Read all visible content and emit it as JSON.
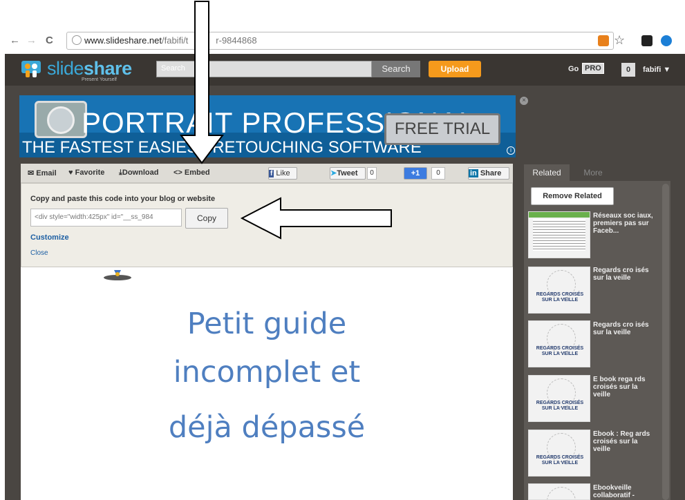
{
  "browser": {
    "url_host": "www.slideshare.net",
    "url_path": "/fabifi/t",
    "url_tail": "r-9844868"
  },
  "header": {
    "logo_slide": "slide",
    "logo_share": "share",
    "tagline": "Present Yourself",
    "search_placeholder": "Search",
    "search_button": "Search",
    "upload_button": "Upload",
    "go_label": "Go",
    "pro_label": "PRO",
    "notification_count": "0",
    "username": "fabifi ▼"
  },
  "ad": {
    "title": "PORTRAIT PROFESSIONAL",
    "subtitle": "THE FASTEST EASIEST RETOUCHING SOFTWARE",
    "cta": "FREE TRIAL",
    "close": "×",
    "info": "i"
  },
  "toolbar": {
    "email": "Email",
    "favorite": "Favorite",
    "download": "Download",
    "embed": "Embed",
    "like": "Like",
    "tweet": "Tweet",
    "tweet_count": "0",
    "plusone": "+1",
    "plusone_count": "0",
    "share": "Share"
  },
  "embed": {
    "title": "Copy and paste this code into your blog or website",
    "code": "<div style=\"width:425px\" id=\"__ss_984",
    "copy_button": "Copy",
    "customize": "Customize",
    "close": "Close"
  },
  "slide": {
    "lines": [
      "Petit guide",
      "incomplet et",
      "déjà dépassé"
    ]
  },
  "related": {
    "tab_related": "Related",
    "tab_more": "More",
    "remove_button": "Remove Related",
    "items": [
      {
        "title": "Réseaux soc iaux, premiers pas sur Faceb...",
        "thumb": "document"
      },
      {
        "title": "Regards cro isés sur la veille",
        "thumb": "regards"
      },
      {
        "title": "Regards cro isés sur la veille",
        "thumb": "regards"
      },
      {
        "title": "E book rega rds croisés sur la veille",
        "thumb": "regards"
      },
      {
        "title": "Ebook : Reg ards croisés sur la veille",
        "thumb": "regards"
      },
      {
        "title": "Ebookveille collaboratif -",
        "thumb": "regards"
      }
    ],
    "thumb_caption_1": "REGARDS CROISÉS",
    "thumb_caption_2": "SUR LA VEILLE"
  },
  "colors": {
    "header_bg": "#3a3632",
    "upload_orange": "#f59a1c",
    "link_blue": "#1d5fa3",
    "slide_text_blue": "#4f7fc0"
  }
}
